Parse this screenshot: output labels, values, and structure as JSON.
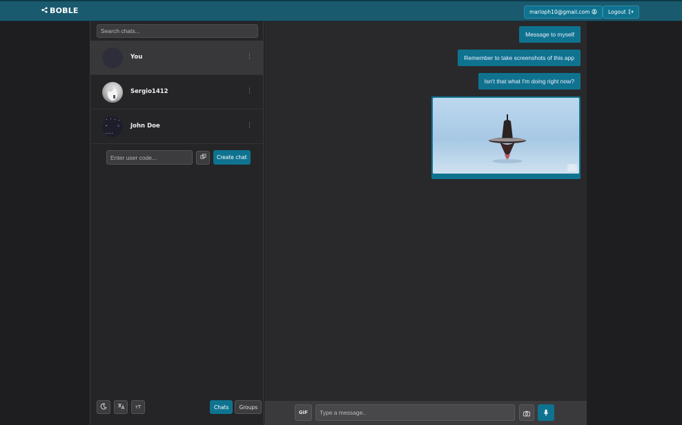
{
  "header": {
    "brand": "BOBLE",
    "brand_icon": "share-nodes-icon",
    "email_button": "marioph10@gmail.com",
    "logout_button": "Logout"
  },
  "sidebar": {
    "search_placeholder": "Search chats...",
    "chats": [
      {
        "name": "You",
        "active": true
      },
      {
        "name": "Sergio1412",
        "active": false
      },
      {
        "name": "John Doe",
        "active": false
      }
    ],
    "user_code_placeholder": "Enter user code...",
    "create_chat_label": "Create chat",
    "tools": [
      "moon-icon",
      "translate-icon",
      "text-size-icon"
    ],
    "text_size_glyph": "тT",
    "tabs": [
      {
        "label": "Chats",
        "active": true
      },
      {
        "label": "Groups",
        "active": false
      }
    ]
  },
  "chat": {
    "messages": [
      {
        "type": "text",
        "text": "Message to myself"
      },
      {
        "type": "text",
        "text": "Remember to take screenshots of this app"
      },
      {
        "type": "text",
        "text": "Isn't that what I'm doing right now?"
      },
      {
        "type": "image",
        "description": "spinning-top-photo"
      }
    ],
    "gif_label": "GIF",
    "message_placeholder": "Type a message.."
  },
  "colors": {
    "accent": "#0f7390",
    "topbar": "#1a5a6e",
    "background": "#1e1e20"
  }
}
